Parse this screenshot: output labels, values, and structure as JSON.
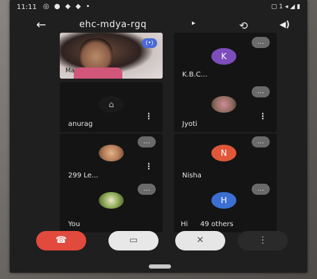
{
  "status": {
    "time": "11:11",
    "icons_left": "◎ ● ◆ ◆ •",
    "icons_right": "▢ 1 ◂ ◢ ▮"
  },
  "header": {
    "meet_code": "ehc-mdya-rgq",
    "caret": "▸",
    "back_icon": "←",
    "camera_switch_icon": "⟲",
    "speaker_icon": "◀)"
  },
  "tiles": {
    "me": {
      "name": "Ma",
      "badge": "(•)"
    },
    "kbc": {
      "name": "K.B.C...",
      "initial": "K",
      "avatar_color": "#7c4dbb",
      "more": "…"
    },
    "anurag": {
      "name": "anurag",
      "more": "⋮"
    },
    "jyoti": {
      "name": "Jyoti",
      "more": "⋮"
    },
    "jyoti_more": {
      "more": "…"
    },
    "le": {
      "name": "299 Le...",
      "more": "⋮"
    },
    "le_more": {
      "more": "…"
    },
    "nisha": {
      "name": "Nisha",
      "initial": "N",
      "avatar_color": "#e0573a",
      "more": "…"
    },
    "you": {
      "name": "You"
    },
    "you_more": {
      "more": "…"
    },
    "others": {
      "name_prefix": "Hi",
      "name": "49 others",
      "initial": "H",
      "avatar_color": "#3b6fd1",
      "more": "…"
    }
  },
  "controls": {
    "end_call_icon": "☎",
    "camera_icon": "▭",
    "mic_icon": "✕",
    "more_icon": "⋮"
  }
}
